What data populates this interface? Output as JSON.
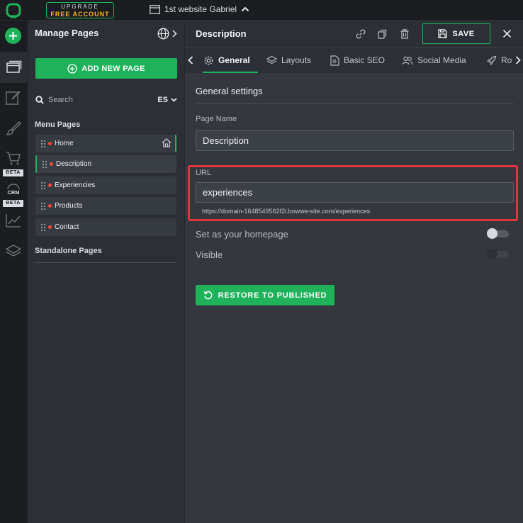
{
  "topbar": {
    "upgrade_line1": "UPGRADE",
    "upgrade_line2": "FREE ACCOUNT",
    "website_name": "1st website Gabriel"
  },
  "rail": {
    "beta_1": "BETA",
    "beta_2": "BETA",
    "crm_label": "CRM"
  },
  "panel": {
    "title": "Manage Pages",
    "add_button": "ADD NEW PAGE",
    "search_placeholder": "Search",
    "language": "ES",
    "menu_pages_label": "Menu Pages",
    "menu_pages": [
      {
        "label": "Home"
      },
      {
        "label": "Description"
      },
      {
        "label": "Experiencies"
      },
      {
        "label": "Products"
      },
      {
        "label": "Contact"
      }
    ],
    "standalone_label": "Standalone Pages"
  },
  "editor": {
    "title": "Description",
    "save_label": "SAVE",
    "tabs": [
      {
        "label": "General"
      },
      {
        "label": "Layouts"
      },
      {
        "label": "Basic SEO"
      },
      {
        "label": "Social Media"
      },
      {
        "label": "Ro"
      }
    ],
    "section_title": "General settings",
    "page_name_label": "Page Name",
    "page_name_value": "Description",
    "url_label": "URL",
    "url_value": "experiences",
    "url_full": "https://domain-1648549562f2i.bowwe-site.com/experiences",
    "homepage_label": "Set as your homepage",
    "visible_label": "Visible",
    "restore_label": "RESTORE TO PUBLISHED"
  },
  "colors": {
    "accent": "#1fb25a",
    "highlight": "#e0353f",
    "page_dot": "#f04b3a",
    "upgrade_text": "#ffb020"
  }
}
